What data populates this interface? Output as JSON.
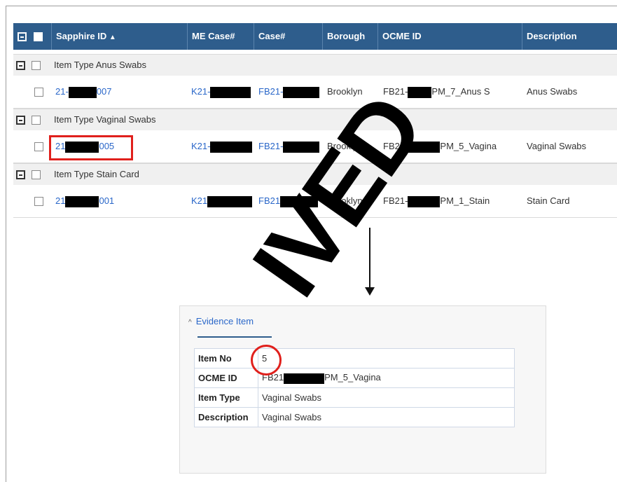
{
  "table": {
    "columns": [
      "Sapphire ID",
      "ME Case#",
      "Case#",
      "Borough",
      "OCME ID",
      "Description"
    ],
    "sort_indicator": "▲",
    "groups": [
      {
        "label": "Item Type Anus Swabs",
        "row": {
          "sapphire_pre": "21-",
          "sapphire_post": "007",
          "me_case_pre": "K21-",
          "case_pre": "FB21-",
          "borough": "Brooklyn",
          "ocme_pre": "FB21-",
          "ocme_post": "PM_7_Anus S",
          "description": "Anus Swabs"
        }
      },
      {
        "label": "Item Type Vaginal Swabs",
        "row": {
          "sapphire_pre": "21",
          "sapphire_post": "005",
          "me_case_pre": "K21-",
          "case_pre": "FB21-",
          "borough": "Brooklyn",
          "ocme_pre": "FB21-",
          "ocme_post": "PM_5_Vagina",
          "description": "Vaginal Swabs"
        }
      },
      {
        "label": "Item Type Stain Card",
        "row": {
          "sapphire_pre": "21",
          "sapphire_post": "001",
          "me_case_pre": "K21",
          "case_pre": "FB21",
          "borough": "Brooklyn",
          "ocme_pre": "FB21-",
          "ocme_post": "PM_1_Stain",
          "description": "Stain Card"
        }
      }
    ]
  },
  "panel": {
    "title": "Evidence Item",
    "fields": [
      {
        "key": "Item No",
        "value": "5"
      },
      {
        "key": "OCME ID",
        "value_pre": "FB21",
        "value_post": "PM_5_Vagina"
      },
      {
        "key": "Item Type",
        "value": "Vaginal Swabs"
      },
      {
        "key": "Description",
        "value": "Vaginal Swabs"
      }
    ]
  },
  "watermark": "IVED",
  "colors": {
    "header_bg": "#2e5d8c",
    "link": "#2a67c9",
    "highlight": "#e0201c"
  }
}
